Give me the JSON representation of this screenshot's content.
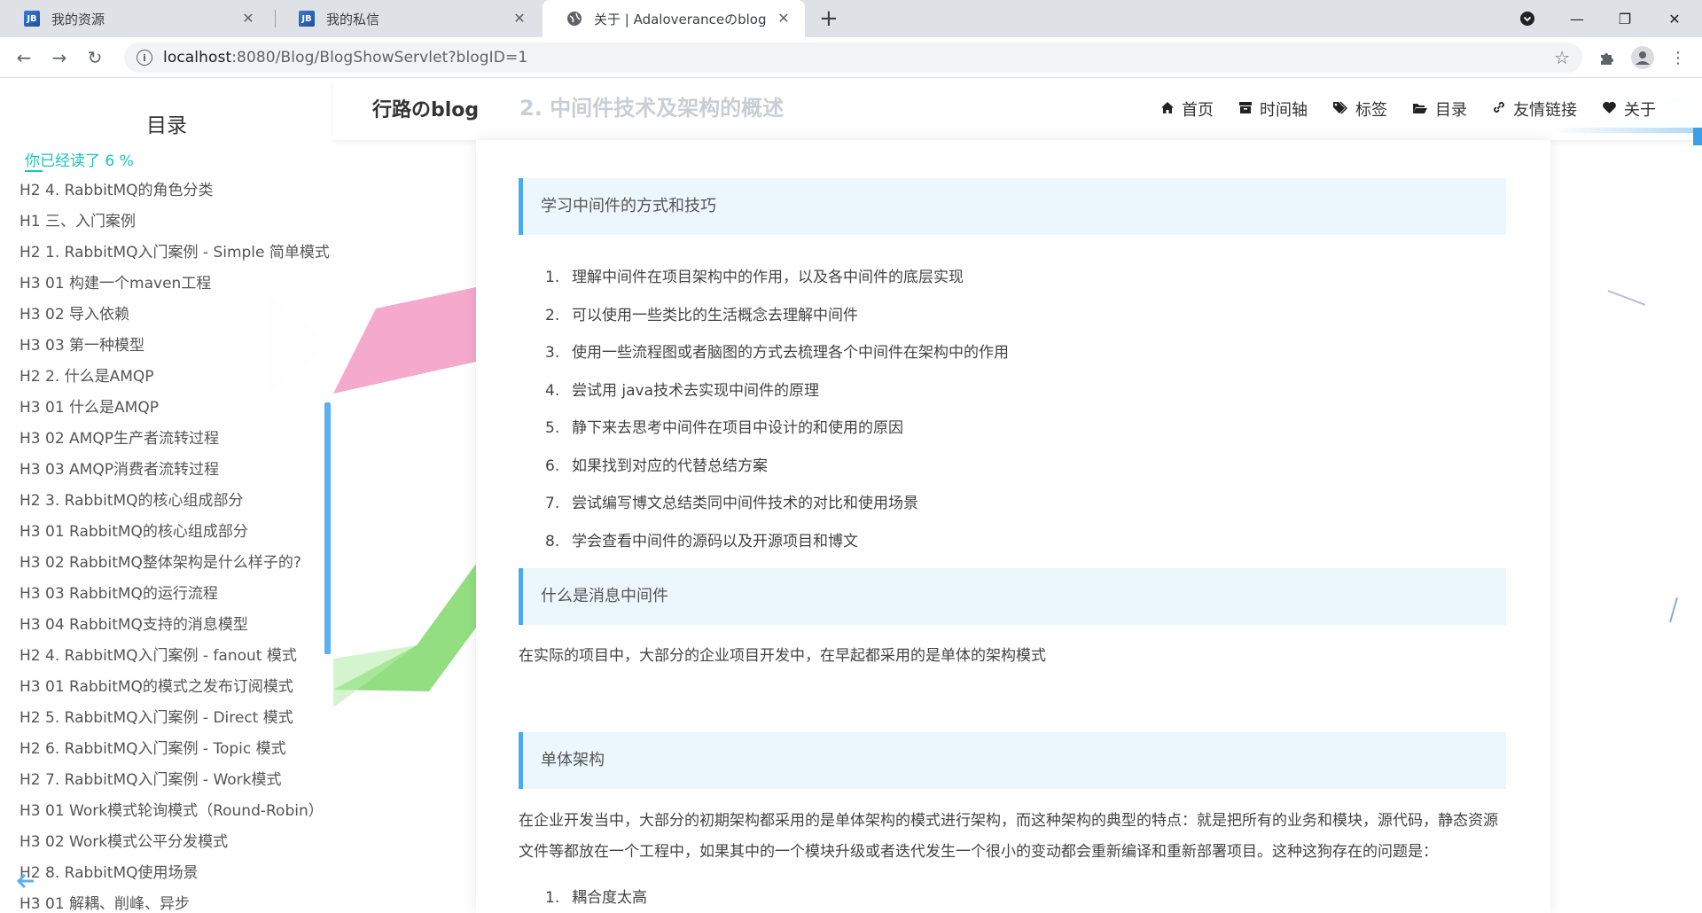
{
  "browser": {
    "tabs": [
      {
        "title": "我的资源"
      },
      {
        "title": "我的私信"
      },
      {
        "title": "关于 | Adaloveranceのblog"
      }
    ],
    "url_host": "localhost",
    "url_rest": ":8080/Blog/BlogShowServlet?blogID=1"
  },
  "toc": {
    "title": "目录",
    "progress": "你已经读了  6  %",
    "items": [
      "H2 4. RabbitMQ的角色分类",
      "H1 三、入门案例",
      "H2 1. RabbitMQ入门案例 - Simple 简单模式",
      "H3 01 构建一个maven工程",
      "H3 02 导入依赖",
      "H3 03 第一种模型",
      "H2 2. 什么是AMQP",
      "H3 01 什么是AMQP",
      "H3 02 AMQP生产者流转过程",
      "H3 03 AMQP消费者流转过程",
      "H2 3. RabbitMQ的核心组成部分",
      "H3 01 RabbitMQ的核心组成部分",
      "H3 02 RabbitMQ整体架构是什么样子的?",
      "H3 03 RabbitMQ的运行流程",
      "H3 04 RabbitMQ支持的消息模型",
      "H2 4. RabbitMQ入门案例 - fanout 模式",
      "H3 01 RabbitMQ的模式之发布订阅模式",
      "H2 5. RabbitMQ入门案例 - Direct 模式",
      "H2 6. RabbitMQ入门案例 - Topic 模式",
      "H2 7. RabbitMQ入门案例 - Work模式",
      "H3 01 Work模式轮询模式（Round-Robin）",
      "H3 02 Work模式公平分发模式",
      "H2 8. RabbitMQ使用场景",
      "H3 01 解耦、削峰、异步"
    ]
  },
  "header": {
    "logo": "行路のblog",
    "faded_title": "2. 中间件技术及架构的概述",
    "nav": [
      {
        "label": "首页",
        "icon": "home-icon"
      },
      {
        "label": "时间轴",
        "icon": "archive-icon"
      },
      {
        "label": "标签",
        "icon": "tags-icon"
      },
      {
        "label": "目录",
        "icon": "folder-open-icon"
      },
      {
        "label": "友情链接",
        "icon": "link-icon"
      },
      {
        "label": "关于",
        "icon": "heart-icon"
      }
    ]
  },
  "article": {
    "section1": "学习中间件的方式和技巧",
    "list1": [
      "理解中间件在项目架构中的作用，以及各中间件的底层实现",
      "可以使用一些类比的生活概念去理解中间件",
      "使用一些流程图或者脑图的方式去梳理各个中间件在架构中的作用",
      "尝试用 java技术去实现中间件的原理",
      "静下来去思考中间件在项目中设计的和使用的原因",
      "如果找到对应的代替总结方案",
      "尝试编写博文总结类同中间件技术的对比和使用场景",
      "学会查看中间件的源码以及开源项目和博文"
    ],
    "section2": "什么是消息中间件",
    "para2": "在实际的项目中，大部分的企业项目开发中，在早起都采用的是单体的架构模式",
    "section3": "单体架构",
    "para3": "在企业开发当中，大部分的初期架构都采用的是单体架构的模式进行架构，而这种架构的典型的特点：就是把所有的业务和模块，源代码，静态资源文件等都放在一个工程中，如果其中的一个模块升级或者迭代发生一个很小的变动都会重新编译和重新部署项目。这种这狗存在的问题是：",
    "list3_first": "耦合度太高"
  }
}
